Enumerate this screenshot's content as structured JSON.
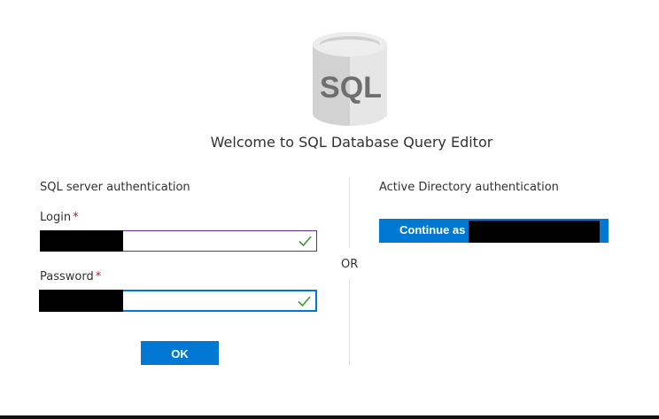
{
  "header": {
    "logo_text": "SQL",
    "welcome_title": "Welcome to SQL Database Query Editor"
  },
  "sql_auth": {
    "title": "SQL server authentication",
    "login_label": "Login",
    "password_label": "Password",
    "required_marker": "*",
    "login_value": "",
    "password_value": "",
    "ok_label": "OK"
  },
  "separator": {
    "or_label": "OR"
  },
  "ad_auth": {
    "title": "Active Directory authentication",
    "continue_label": "Continue as"
  },
  "colors": {
    "accent": "#0078d4",
    "required": "#a4262c",
    "valid_check": "#3c9b2c",
    "login_border": "#6b2c91"
  },
  "icons": {
    "logo": "sql-database-cylinder-icon",
    "valid": "checkmark-icon"
  }
}
